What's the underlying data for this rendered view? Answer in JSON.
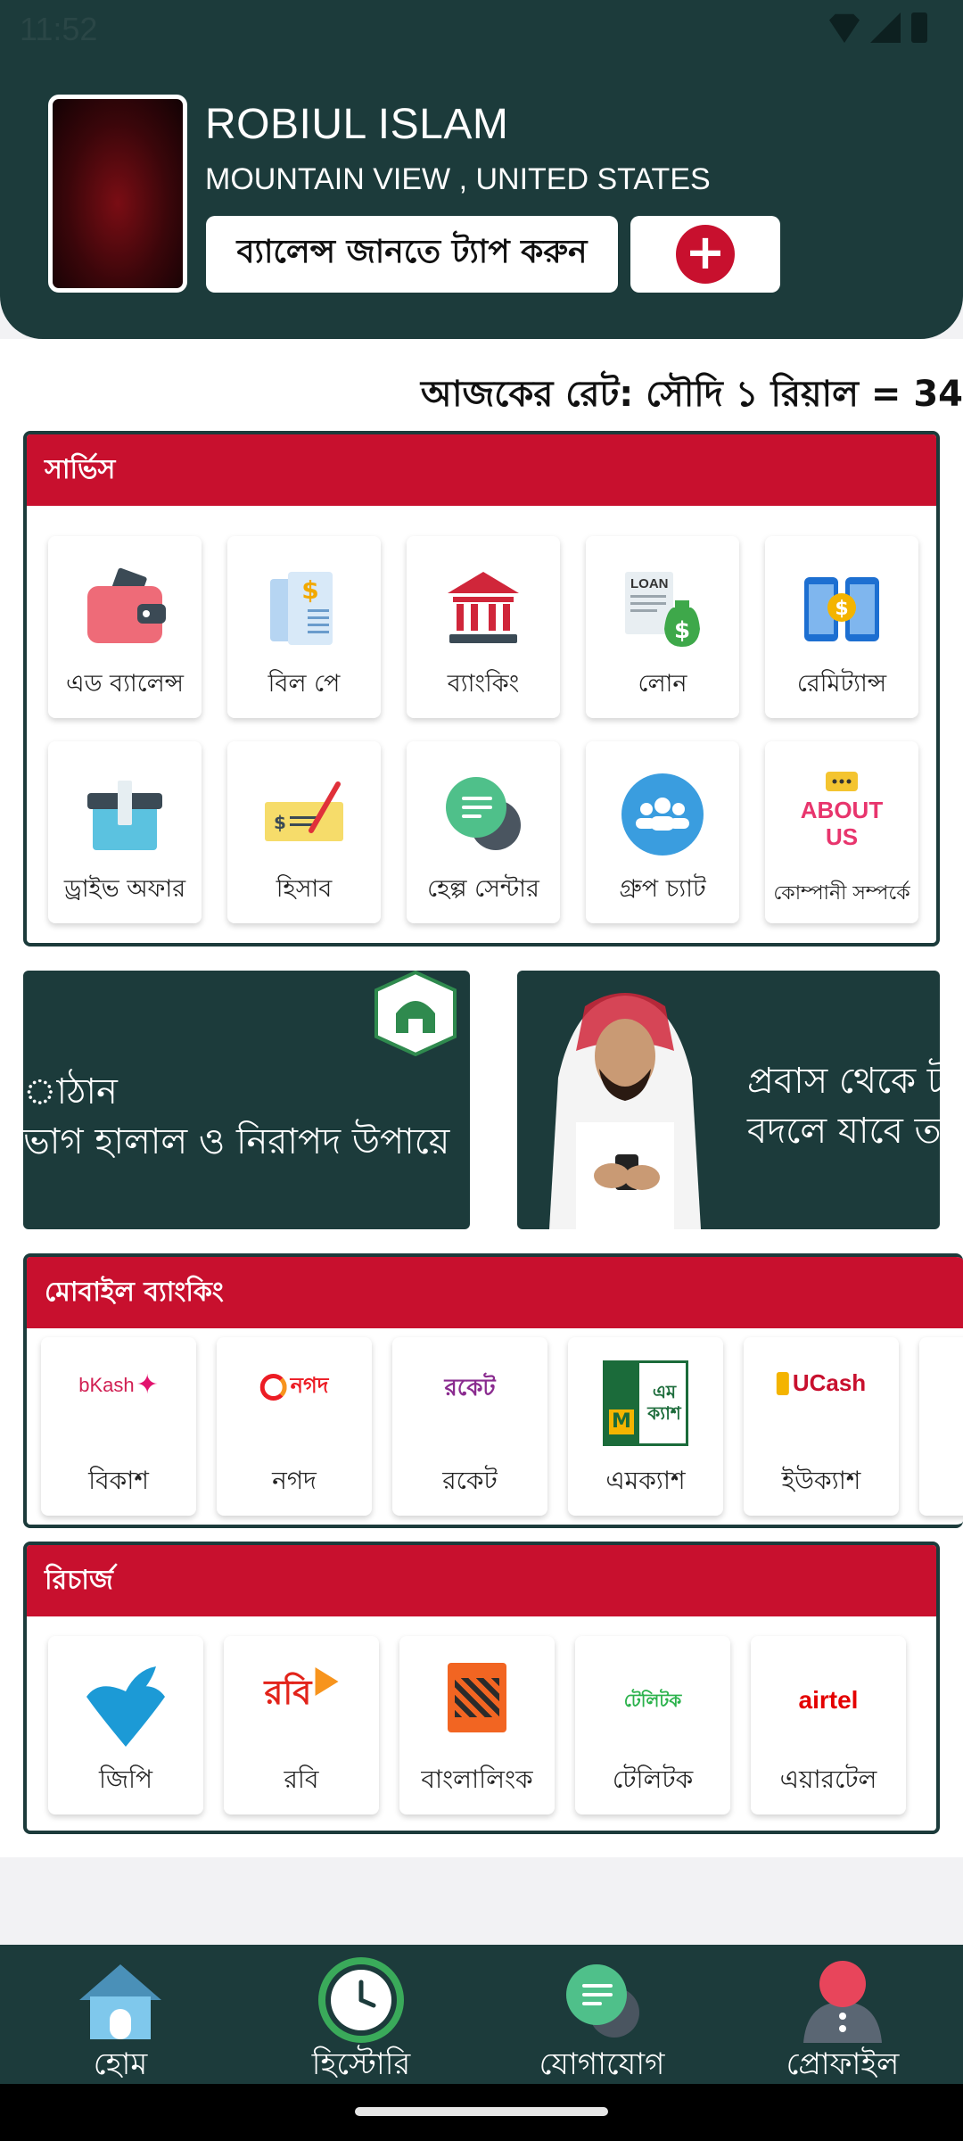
{
  "status_bar": {
    "time": "11:52"
  },
  "profile": {
    "name": "ROBIUL ISLAM",
    "location": "MOUNTAIN VIEW , UNITED STATES",
    "balance_button": "ব্যালেন্স জানতে ট্যাপ করুন",
    "add_button_symbol": "+"
  },
  "rate_ticker": "আজকের রেট: সৌদি ১ রিয়াল = 34",
  "services": {
    "title": "সার্ভিস",
    "items": [
      {
        "label": "এড ব্যালেন্স",
        "icon": "wallet-icon"
      },
      {
        "label": "বিল পে",
        "icon": "bill-icon"
      },
      {
        "label": "ব্যাংকিং",
        "icon": "bank-icon"
      },
      {
        "label": "লোন",
        "icon": "loan-icon"
      },
      {
        "label": "রেমিট্যান্স",
        "icon": "remittance-icon"
      },
      {
        "label": "ড্রাইভ অফার",
        "icon": "gift-box-icon"
      },
      {
        "label": "হিসাব",
        "icon": "cheque-icon"
      },
      {
        "label": "হেল্প সেন্টার",
        "icon": "chat-bubbles-icon"
      },
      {
        "label": "গ্রুপ চ্যাট",
        "icon": "group-icon"
      },
      {
        "label": "কোম্পানী সম্পর্কে",
        "icon": "about-us-icon",
        "icon_text": "ABOUT US"
      }
    ]
  },
  "banners": [
    {
      "line1": "াঠান",
      "line2": "ভাগ হালাল ও নিরাপদ উপায়ে"
    },
    {
      "line1": "প্রবাস থেকে ট",
      "line2": "বদলে যাবে ত"
    }
  ],
  "mobile_banking": {
    "title": "মোবাইল ব্যাংকিং",
    "items": [
      {
        "label": "বিকাশ",
        "logo_text": "bKash"
      },
      {
        "label": "নগদ",
        "logo_text": "নগদ"
      },
      {
        "label": "রকেট",
        "logo_text": "রকেট"
      },
      {
        "label": "এমক্যাশ",
        "logo_text": "এম ক্যাশ"
      },
      {
        "label": "ইউক্যাশ",
        "logo_text": "UCash"
      }
    ]
  },
  "recharge": {
    "title": "রিচার্জ",
    "items": [
      {
        "label": "জিপি",
        "icon": "grameenphone-logo-icon"
      },
      {
        "label": "রবি",
        "logo_text": "রবি"
      },
      {
        "label": "বাংলালিংক",
        "icon": "banglalink-logo-icon"
      },
      {
        "label": "টেলিটক",
        "logo_text": "টেলিটক"
      },
      {
        "label": "এয়ারটেল",
        "logo_text": "airtel"
      }
    ]
  },
  "bottom_nav": [
    {
      "label": "হোম",
      "icon": "home-icon"
    },
    {
      "label": "হিস্টোরি",
      "icon": "history-clock-icon"
    },
    {
      "label": "যোগাযোগ",
      "icon": "contact-chat-icon"
    },
    {
      "label": "প্রোফাইল",
      "icon": "profile-icon"
    }
  ],
  "colors": {
    "primary_dark": "#1c3b3b",
    "accent_red": "#c8102e"
  }
}
